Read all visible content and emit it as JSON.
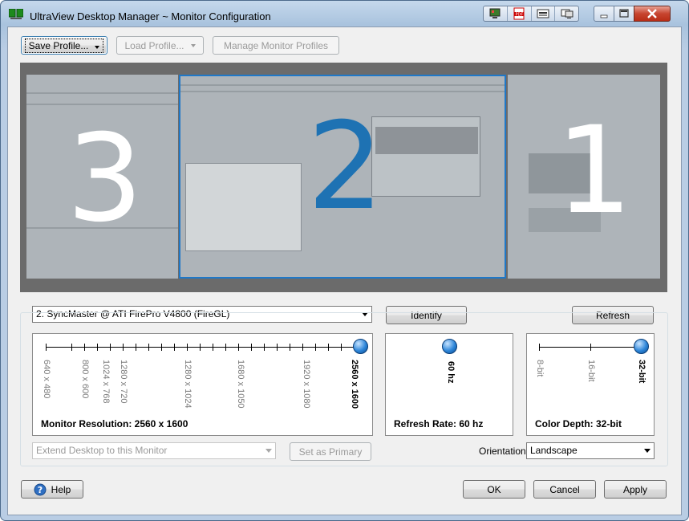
{
  "window": {
    "title": "UltraView Desktop Manager ~ Monitor Configuration",
    "accent": "#1e72b3",
    "toolbar_icons": [
      "monitor-config-icon",
      "pdf-icon",
      "taskbar-icon",
      "monitor-settings-icon"
    ]
  },
  "top_buttons": {
    "save_profile": "Save Profile...",
    "load_profile": "Load Profile...",
    "manage_profiles": "Manage Monitor Profiles"
  },
  "monitors": [
    {
      "number": "3"
    },
    {
      "number": "2"
    },
    {
      "number": "1"
    }
  ],
  "monitor_select": {
    "value": "2. SyncMaster @ ATI FirePro V4800 (FireGL)"
  },
  "buttons": {
    "identify": "Identify",
    "refresh": "Refresh",
    "set_primary": "Set as Primary",
    "help": "Help",
    "ok": "OK",
    "cancel": "Cancel",
    "apply": "Apply"
  },
  "resolution": {
    "ticks": [
      "640 x 480",
      "800 x 600",
      "1024 x 768",
      "1280 x 720",
      "1280 x 1024",
      "1680 x 1050",
      "1920 x 1080",
      "2560 x 1600"
    ],
    "selected": "2560 x 1600",
    "caption": "Monitor Resolution: 2560 x 1600"
  },
  "refresh_rate": {
    "ticks": [
      "60 hz"
    ],
    "selected": "60 hz",
    "caption": "Refresh Rate: 60 hz"
  },
  "color_depth": {
    "ticks": [
      "8-bit",
      "16-bit",
      "32-bit"
    ],
    "selected": "32-bit",
    "caption": "Color Depth: 32-bit"
  },
  "extend_desktop": {
    "value": "Extend Desktop to this Monitor"
  },
  "orientation": {
    "label": "Orientation:",
    "value": "Landscape"
  }
}
